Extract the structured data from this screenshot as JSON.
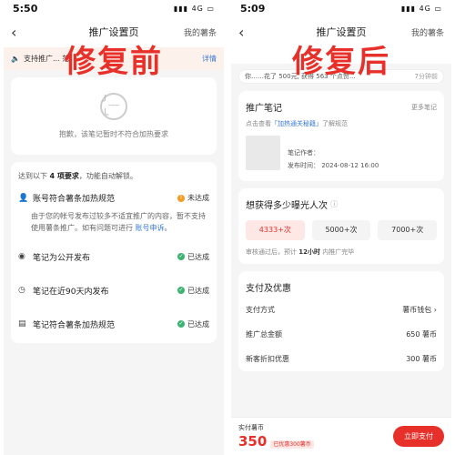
{
  "left": {
    "status_time": "5:50",
    "signal": "4G",
    "title": "推广设置页",
    "right_link": "我的薯条",
    "overlay": "修复前",
    "notice_text": "支持推广... 范。",
    "notice_more": "详情",
    "blocked_msg": "抱歉，该笔记暂时不符合加热要求",
    "req_head_a": "达到以下",
    "req_head_b": "4 项要求",
    "req_head_c": "，功能自动解锁。",
    "reqs": [
      {
        "label": "账号符合薯条加热规范",
        "status": "未达成",
        "desc": "由于您的帐号发布过较多不适宜推广的内容，暂不支持使用薯条推广。如有问题可进行 ",
        "link": "账号申诉",
        "tail": "。"
      },
      {
        "label": "笔记为公开发布",
        "status": "已达成"
      },
      {
        "label": "笔记在近90天内发布",
        "status": "已达成"
      },
      {
        "label": "笔记符合薯条加热规范",
        "status": "已达成"
      }
    ]
  },
  "right": {
    "status_time": "5:09",
    "signal": "4G",
    "title": "推广设置页",
    "right_link": "我的薯条",
    "overlay": "修复后",
    "promo_text": "你……花了 500元, 获得 563 个点赞...",
    "promo_time": "7分钟前",
    "note_title": "推广笔记",
    "note_more": "更多笔记",
    "hint_a": "点击查看",
    "hint_link": "「加热通关秘籍」",
    "hint_b": "了解规范",
    "author": "笔记作者：",
    "pubtime": "发布时间：  2024-08-12 16:00",
    "exposure_title": "想获得多少曝光人次",
    "opts": [
      "4333+次",
      "5000+次",
      "7000+次"
    ],
    "est_a": "审核通过后，预计",
    "est_b": "12小时",
    "est_c": "内推广完毕",
    "pay_title": "支付及优惠",
    "pay_rows": [
      {
        "label": "支付方式",
        "val": "薯币钱包 ›"
      },
      {
        "label": "推广总金额",
        "val": "650 薯币"
      },
      {
        "label": "新客折扣优惠",
        "val": "300 薯币"
      }
    ],
    "footer_label": "实付薯币",
    "footer_amount": "350",
    "footer_disc": "已优惠300薯币",
    "footer_btn": "立即支付"
  }
}
